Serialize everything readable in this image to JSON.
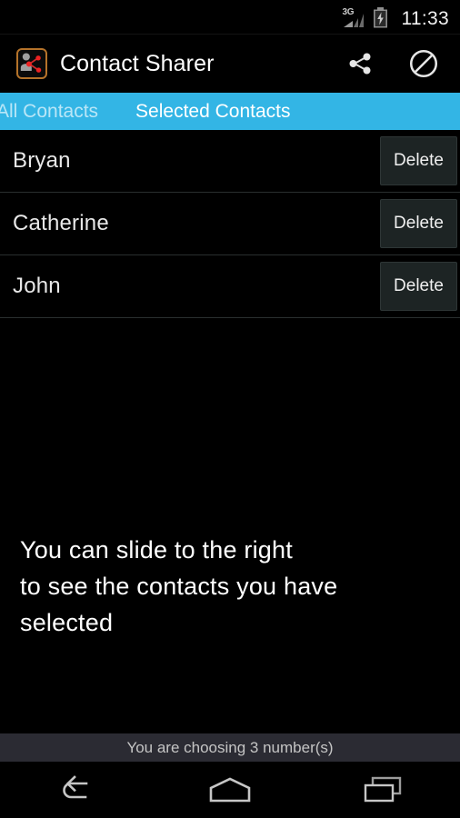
{
  "status_bar": {
    "network_label": "3G",
    "signal_icon": "signal-bars-icon",
    "battery_icon": "battery-charging-icon",
    "clock": "11:33"
  },
  "app_bar": {
    "icon": "contact-sharer-app-icon",
    "title": "Contact Sharer",
    "actions": [
      {
        "name": "share-icon",
        "label": "Share"
      },
      {
        "name": "block-icon",
        "label": "Block"
      }
    ]
  },
  "tabs": {
    "accent_color": "#33b5e5",
    "items": [
      {
        "label": "All Contacts",
        "active": false
      },
      {
        "label": "Selected Contacts",
        "active": true
      }
    ]
  },
  "contacts": {
    "delete_label": "Delete",
    "rows": [
      {
        "name": "Bryan"
      },
      {
        "name": "Catherine"
      },
      {
        "name": "John"
      }
    ]
  },
  "hint": {
    "line1": "You can slide to the right",
    "line2": "to see the contacts you have",
    "line3": "selected"
  },
  "footer": {
    "status": "You are choosing 3 number(s)",
    "count": 3
  },
  "nav_bar": {
    "back": "back-icon",
    "home": "home-icon",
    "recents": "recents-icon"
  }
}
